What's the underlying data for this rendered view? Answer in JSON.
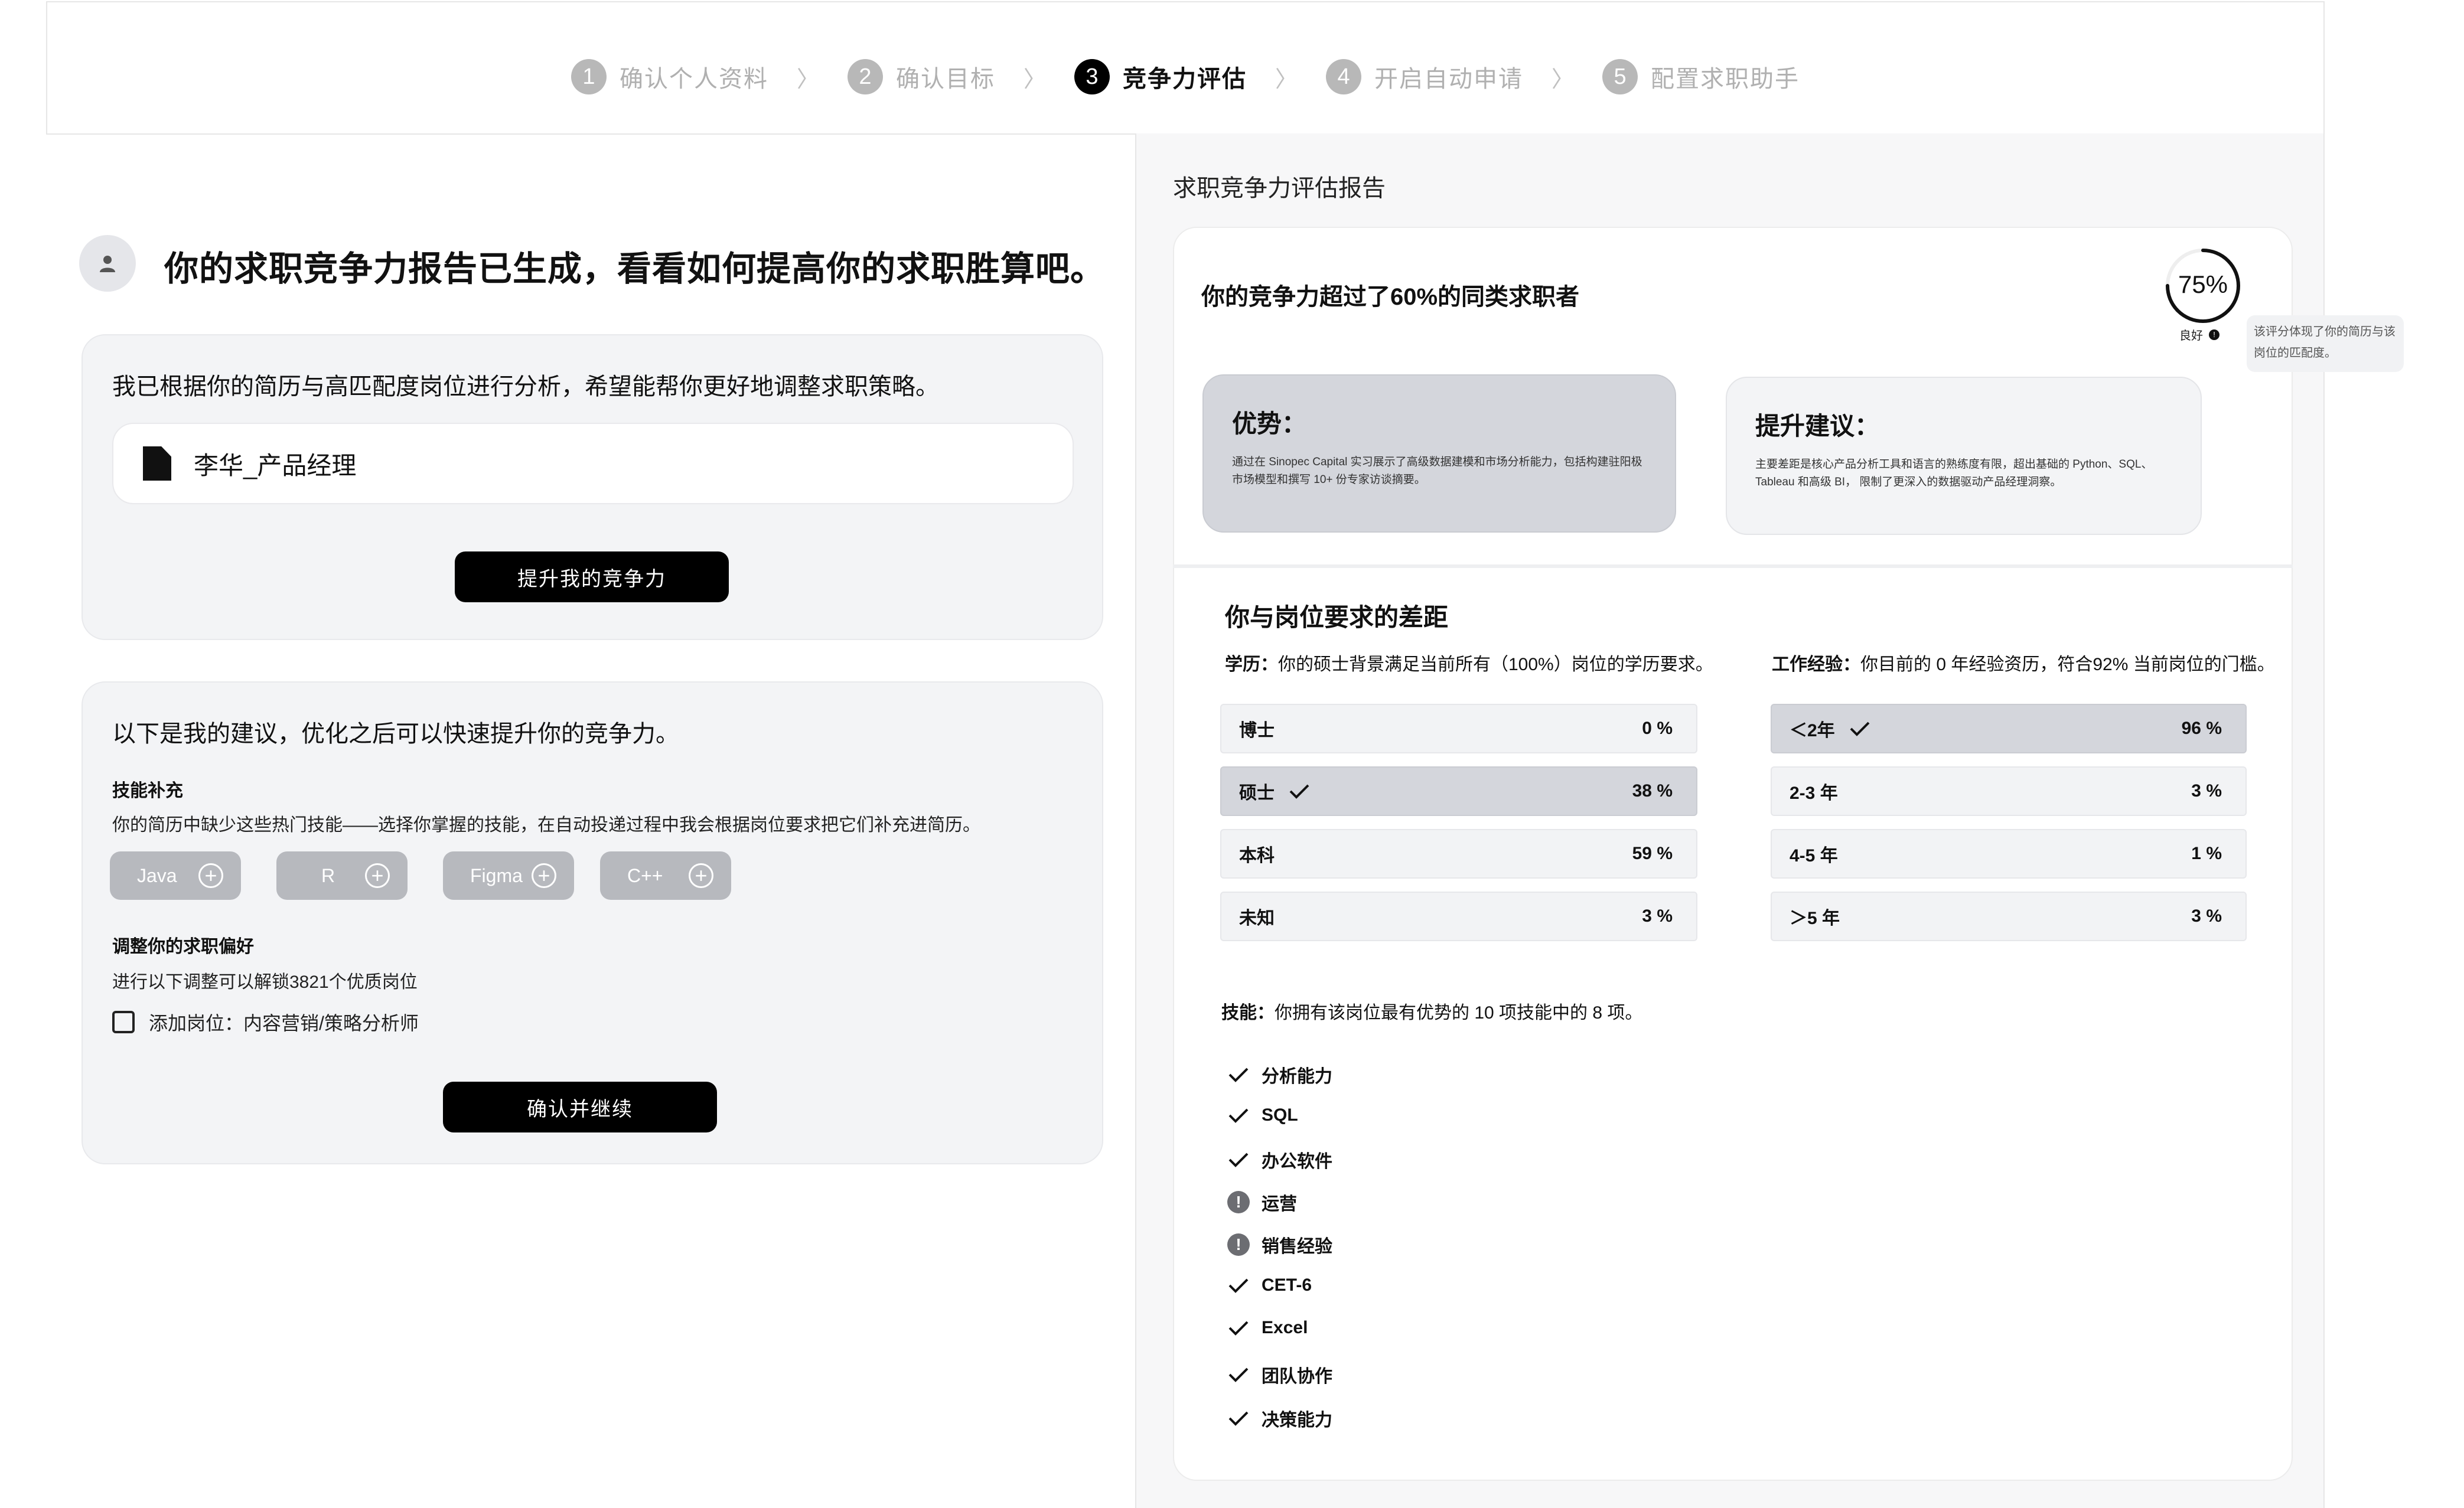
{
  "steps": [
    {
      "num": "1",
      "label": "确认个人资料"
    },
    {
      "num": "2",
      "label": "确认目标"
    },
    {
      "num": "3",
      "label": "竞争力评估"
    },
    {
      "num": "4",
      "label": "开启自动申请"
    },
    {
      "num": "5",
      "label": "配置求职助手"
    }
  ],
  "step_separator": "〉",
  "left": {
    "headline": "你的求职竞争力报告已生成，看看如何提高你的求职胜算吧。",
    "card1": {
      "intro": "我已根据你的简历与高匹配度岗位进行分析，希望能帮你更好地调整求职策略。",
      "file_name": "李华_产品经理",
      "button": "提升我的竞争力"
    },
    "card2": {
      "intro": "以下是我的建议，优化之后可以快速提升你的竞争力。",
      "skills_title": "技能补充",
      "skills_desc": "你的简历中缺少这些热门技能——选择你掌握的技能，在自动投递过程中我会根据岗位要求把它们补充进简历。",
      "chips": [
        "Java",
        "R",
        "Figma",
        "C++"
      ],
      "pref_title": "调整你的求职偏好",
      "pref_desc": "进行以下调整可以解锁3821个优质岗位",
      "checkbox_label": "添加岗位：内容营销/策略分析师",
      "button": "确认并继续"
    }
  },
  "report": {
    "title": "求职竞争力评估报告",
    "score_text": "你的竞争力超过了60%的同类求职者",
    "score_value": "75%",
    "score_fraction": 0.75,
    "rating": "良好",
    "tooltip": "该评分体现了你的简历与该岗位的匹配度。",
    "advantage_title": "优势：",
    "advantage_text": "通过在 Sinopec Capital 实习展示了高级数据建模和市场分析能力，包括构建驻阳极市场模型和撰写 10+ 份专家访谈摘要。",
    "suggestion_title": "提升建议：",
    "suggestion_text": "主要差距是核心产品分析工具和语言的熟练度有限，超出基础的 Python、SQL、Tableau 和高级 BI， 限制了更深入的数据驱动产品经理洞察。",
    "gap_title": "你与岗位要求的差距",
    "edu_label": "学历：",
    "edu_text": "你的硕士背景满足当前所有（100%）岗位的学历要求。",
    "exp_label": "工作经验：",
    "exp_text": "你目前的 0 年经验资历，符合92% 当前岗位的门槛。",
    "education": [
      {
        "label": "博士",
        "pct": "0 %",
        "selected": false
      },
      {
        "label": "硕士",
        "pct": "38 %",
        "selected": true
      },
      {
        "label": "本科",
        "pct": "59 %",
        "selected": false
      },
      {
        "label": "未知",
        "pct": "3 %",
        "selected": false
      }
    ],
    "experience": [
      {
        "label": "＜2年",
        "pct": "96 %",
        "selected": true
      },
      {
        "label": "2-3 年",
        "pct": "3 %",
        "selected": false
      },
      {
        "label": "4-5 年",
        "pct": "1 %",
        "selected": false
      },
      {
        "label": "＞5 年",
        "pct": "3 %",
        "selected": false
      }
    ],
    "skills_label": "技能：",
    "skills_text": "你拥有该岗位最有优势的 10 项技能中的 8 项。",
    "skills": [
      {
        "name": "分析能力",
        "status": "check"
      },
      {
        "name": "SQL",
        "status": "check"
      },
      {
        "name": "办公软件",
        "status": "check"
      },
      {
        "name": "运营",
        "status": "warn"
      },
      {
        "name": "销售经验",
        "status": "warn"
      },
      {
        "name": "CET-6",
        "status": "check"
      },
      {
        "name": "Excel",
        "status": "check"
      },
      {
        "name": "团队协作",
        "status": "check"
      },
      {
        "name": "决策能力",
        "status": "check"
      }
    ]
  }
}
